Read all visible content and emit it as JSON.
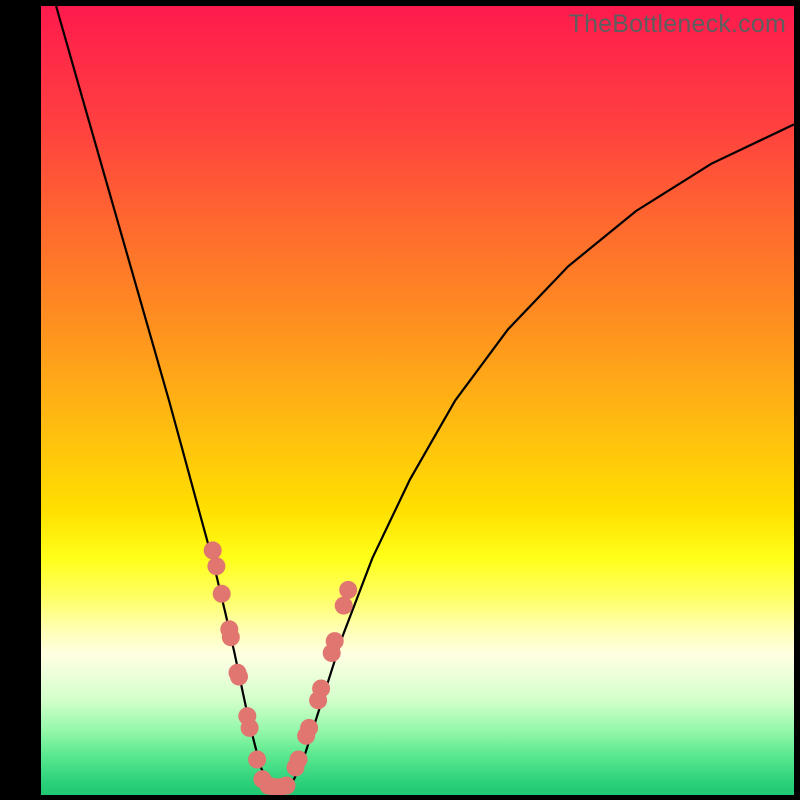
{
  "watermark": "TheBottleneck.com",
  "colors": {
    "frame": "#000000",
    "curve": "#000000",
    "marker": "#e0766f"
  },
  "chart_data": {
    "type": "line",
    "title": "",
    "xlabel": "",
    "ylabel": "",
    "xlim": [
      0,
      100
    ],
    "ylim": [
      0,
      100
    ],
    "grid": false,
    "legend": false,
    "series": [
      {
        "name": "bottleneck-curve",
        "x": [
          2,
          5,
          8,
          11,
          14,
          17,
          19,
          21,
          23,
          24.5,
          25.7,
          26.8,
          27.7,
          28.5,
          29.2,
          30.0,
          31.2,
          32.4,
          33.6,
          35.0,
          37.0,
          40.0,
          44.0,
          49.0,
          55.0,
          62.0,
          70.0,
          79.0,
          89.0,
          100.0
        ],
        "y": [
          100,
          90,
          80,
          70,
          60,
          50,
          43,
          36,
          29,
          23,
          18,
          13,
          9,
          6,
          3.5,
          1.8,
          1.0,
          1.0,
          2.0,
          5.0,
          11.0,
          20.0,
          30.0,
          40.0,
          50.0,
          59.0,
          67.0,
          74.0,
          80.0,
          85.0
        ]
      },
      {
        "name": "markers-left",
        "x": [
          22.8,
          23.3,
          24.0,
          25.0,
          25.2,
          26.1,
          26.3,
          27.4,
          27.7,
          28.7,
          29.4
        ],
        "y": [
          31.0,
          29.0,
          25.5,
          21.0,
          20.0,
          15.5,
          15.0,
          10.0,
          8.5,
          4.5,
          2.0
        ]
      },
      {
        "name": "markers-bottom",
        "x": [
          30.2,
          31.0,
          31.8,
          32.6
        ],
        "y": [
          1.2,
          1.0,
          1.0,
          1.2
        ]
      },
      {
        "name": "markers-right",
        "x": [
          33.8,
          34.2,
          35.2,
          35.6,
          36.8,
          37.2,
          38.6,
          39.0,
          40.2,
          40.8
        ],
        "y": [
          3.5,
          4.5,
          7.5,
          8.5,
          12.0,
          13.5,
          18.0,
          19.5,
          24.0,
          26.0
        ]
      }
    ],
    "background_gradient": {
      "top": "#ff1a4e",
      "mid": "#ffe000",
      "bottom": "#1fc872"
    }
  }
}
